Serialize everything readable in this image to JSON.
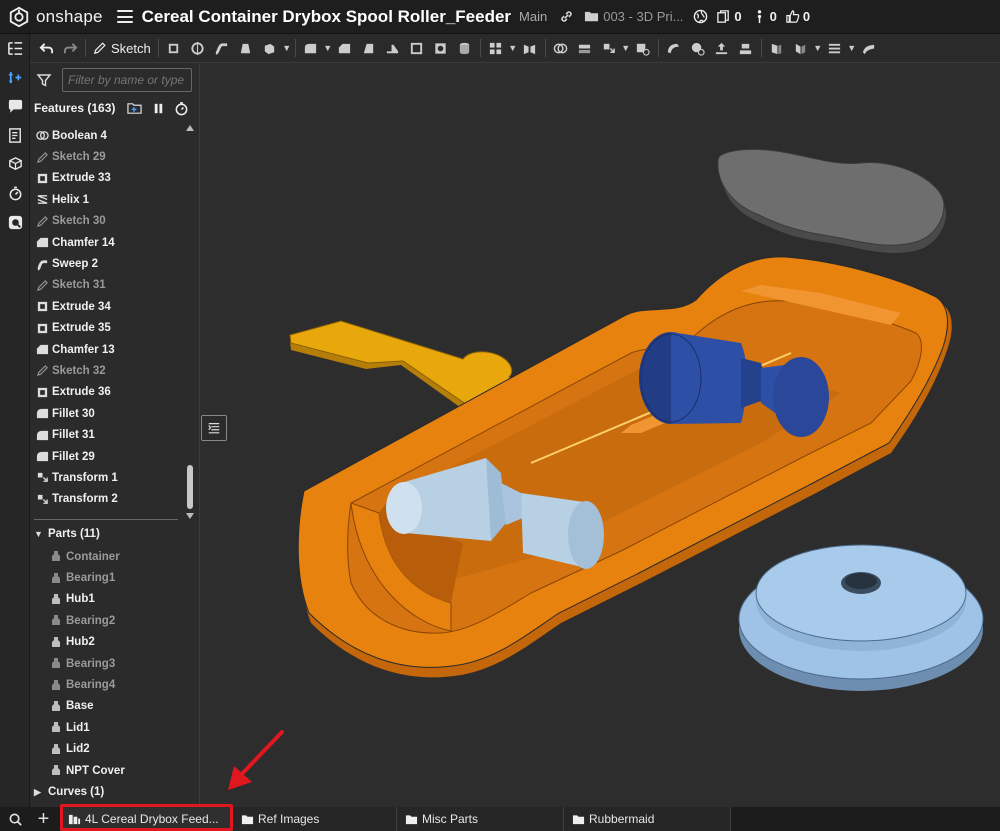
{
  "app": {
    "logo_text": "onshape",
    "document_title": "Cereal Container Drybox Spool Roller_Feeder",
    "branch": "Main",
    "folder_path": "003 - 3D Pri...",
    "versions_count": "0",
    "branches_count": "0",
    "likes_count": "0"
  },
  "toolbar": {
    "sketch_label": "Sketch"
  },
  "feature_panel": {
    "filter_placeholder": "Filter by name or type",
    "features_header": "Features (163)",
    "features": [
      {
        "label": "Boolean 4",
        "icon": "boolean-icon",
        "dim": false
      },
      {
        "label": "Sketch 29",
        "icon": "sketch-icon",
        "dim": true
      },
      {
        "label": "Extrude 33",
        "icon": "extrude-icon",
        "dim": false
      },
      {
        "label": "Helix 1",
        "icon": "helix-icon",
        "dim": false
      },
      {
        "label": "Sketch 30",
        "icon": "sketch-icon",
        "dim": true
      },
      {
        "label": "Chamfer 14",
        "icon": "chamfer-icon",
        "dim": false
      },
      {
        "label": "Sweep 2",
        "icon": "sweep-icon",
        "dim": false
      },
      {
        "label": "Sketch 31",
        "icon": "sketch-icon",
        "dim": true
      },
      {
        "label": "Extrude 34",
        "icon": "extrude-icon",
        "dim": false
      },
      {
        "label": "Extrude 35",
        "icon": "extrude-icon",
        "dim": false
      },
      {
        "label": "Chamfer 13",
        "icon": "chamfer-icon",
        "dim": false
      },
      {
        "label": "Sketch 32",
        "icon": "sketch-icon",
        "dim": true
      },
      {
        "label": "Extrude 36",
        "icon": "extrude-icon",
        "dim": false
      },
      {
        "label": "Fillet 30",
        "icon": "fillet-icon",
        "dim": false
      },
      {
        "label": "Fillet 31",
        "icon": "fillet-icon",
        "dim": false
      },
      {
        "label": "Fillet 29",
        "icon": "fillet-icon",
        "dim": false
      },
      {
        "label": "Transform 1",
        "icon": "transform-icon",
        "dim": false
      },
      {
        "label": "Transform 2",
        "icon": "transform-icon",
        "dim": false
      }
    ],
    "parts_header": "Parts (11)",
    "parts": [
      {
        "label": "Container",
        "dim": true
      },
      {
        "label": "Bearing1",
        "dim": true
      },
      {
        "label": "Hub1",
        "dim": false
      },
      {
        "label": "Bearing2",
        "dim": true
      },
      {
        "label": "Hub2",
        "dim": false
      },
      {
        "label": "Bearing3",
        "dim": true
      },
      {
        "label": "Bearing4",
        "dim": true
      },
      {
        "label": "Base",
        "dim": false
      },
      {
        "label": "Lid1",
        "dim": false
      },
      {
        "label": "Lid2",
        "dim": false
      },
      {
        "label": "NPT Cover",
        "dim": false
      }
    ],
    "curves_header": "Curves (1)"
  },
  "tabs": [
    {
      "label": "4L Cereal Drybox Feed...",
      "icon": "part-studio-icon",
      "active": true
    },
    {
      "label": "Ref Images",
      "icon": "folder-icon",
      "active": false
    },
    {
      "label": "Misc Parts",
      "icon": "folder-icon",
      "active": false
    },
    {
      "label": "Rubbermaid",
      "icon": "folder-icon",
      "active": false
    }
  ],
  "colors": {
    "container_orange": "#e8820f",
    "lid_gray": "#6e6e6e",
    "hub_blue": "#2e4fa6",
    "bearing_lightblue": "#b8d0e4",
    "cover_yellow": "#e8a80c",
    "base_blue": "#9ec3e6",
    "annotation_red": "#e0171f"
  }
}
